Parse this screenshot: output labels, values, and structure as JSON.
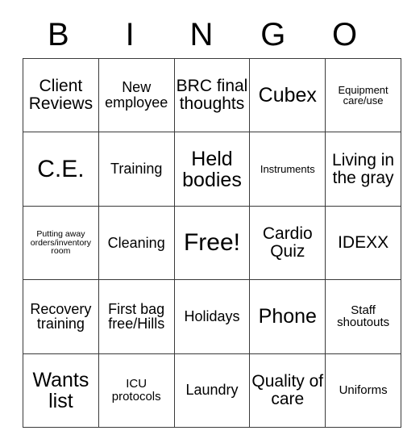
{
  "card": {
    "header_letters": [
      "B",
      "I",
      "N",
      "G",
      "O"
    ],
    "columns": 5,
    "rows": 5,
    "free_space_label": "Free!",
    "border_color": "#3a3a3a",
    "background_color": "#ffffff",
    "text_color": "#000000",
    "cells": [
      [
        {
          "text": "Client Reviews",
          "size": "lg"
        },
        {
          "text": "New employee",
          "size": "md"
        },
        {
          "text": "BRC final thoughts",
          "size": "lg"
        },
        {
          "text": "Cubex",
          "size": "xl"
        },
        {
          "text": "Equipment care/use",
          "size": "xs"
        }
      ],
      [
        {
          "text": "C.E.",
          "size": "xxl"
        },
        {
          "text": "Training",
          "size": "md"
        },
        {
          "text": "Held bodies",
          "size": "xl"
        },
        {
          "text": "Instruments",
          "size": "xs"
        },
        {
          "text": "Living in the gray",
          "size": "lg"
        }
      ],
      [
        {
          "text": "Putting away orders/inventory room",
          "size": "xxs"
        },
        {
          "text": "Cleaning",
          "size": "md"
        },
        {
          "text": "Free!",
          "size": "xxl"
        },
        {
          "text": "Cardio Quiz",
          "size": "lg"
        },
        {
          "text": "IDEXX",
          "size": "lg"
        }
      ],
      [
        {
          "text": "Recovery training",
          "size": "md"
        },
        {
          "text": "First bag free/Hills",
          "size": "md"
        },
        {
          "text": "Holidays",
          "size": "md"
        },
        {
          "text": "Phone",
          "size": "xl"
        },
        {
          "text": "Staff shoutouts",
          "size": "sm"
        }
      ],
      [
        {
          "text": "Wants list",
          "size": "xl"
        },
        {
          "text": "ICU protocols",
          "size": "sm"
        },
        {
          "text": "Laundry",
          "size": "md"
        },
        {
          "text": "Quality of care",
          "size": "lg"
        },
        {
          "text": "Uniforms",
          "size": "sm"
        }
      ]
    ]
  }
}
